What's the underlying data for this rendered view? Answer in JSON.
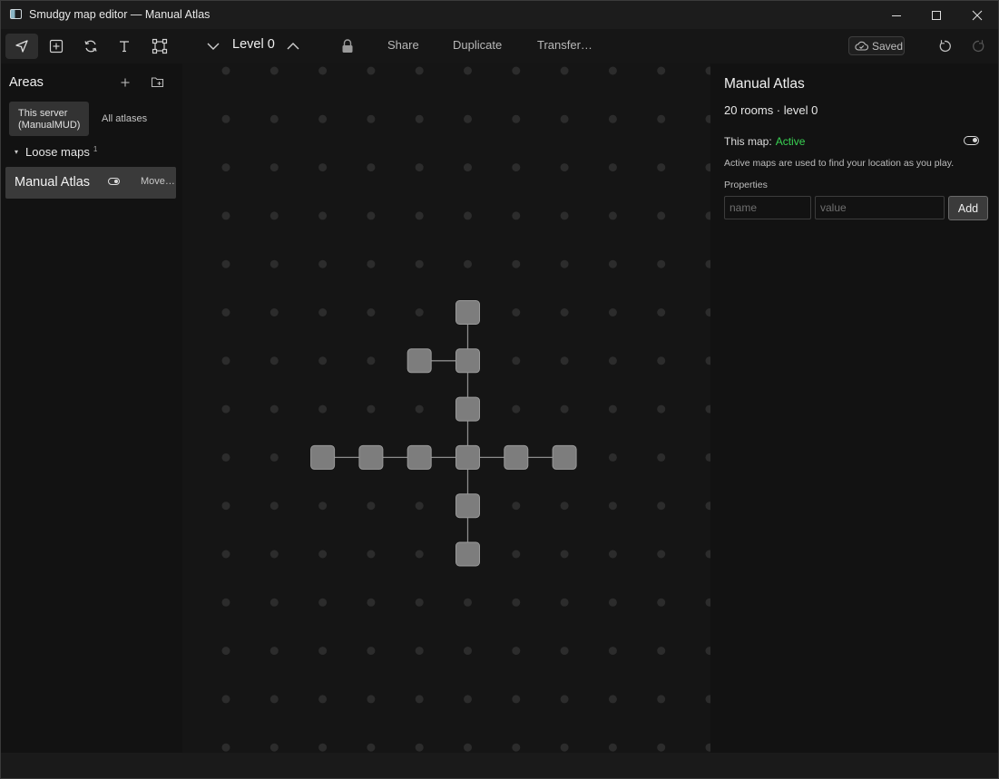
{
  "window": {
    "title": "Smudgy map editor — Manual Atlas",
    "controls": [
      "minimize",
      "maximize",
      "close"
    ]
  },
  "toolbar": {
    "tools": [
      {
        "name": "select-tool",
        "icon": "navigation-arrow-icon",
        "active": true
      },
      {
        "name": "add-room-tool",
        "icon": "plus-square-icon",
        "active": false
      },
      {
        "name": "cycle-tool",
        "icon": "refresh-icon",
        "active": false
      },
      {
        "name": "text-tool",
        "icon": "text-T-icon",
        "active": false
      },
      {
        "name": "area-select-tool",
        "icon": "bounding-box-icon",
        "active": false
      }
    ],
    "level_label": "Level 0",
    "share_label": "Share",
    "duplicate_label": "Duplicate",
    "transfer_label": "Transfer…",
    "saved_label": "Saved"
  },
  "sidebar": {
    "title": "Areas",
    "tab_server": "This server\n(ManualMUD)",
    "tab_all": "All atlases",
    "group_label": "Loose maps",
    "group_count": "1",
    "map_item": {
      "name": "Manual Atlas",
      "move_label": "Move…"
    }
  },
  "panel": {
    "title": "Manual Atlas",
    "subtitle": "20 rooms · level 0",
    "map_label": "This map:",
    "map_status": "Active",
    "note": "Active maps are used to find your location as you play.",
    "properties_label": "Properties",
    "name_placeholder": "name",
    "value_placeholder": "value",
    "add_label": "Add"
  },
  "map": {
    "rooms": [
      {
        "col": 5,
        "row": 5
      },
      {
        "col": 4,
        "row": 6
      },
      {
        "col": 5,
        "row": 6
      },
      {
        "col": 5,
        "row": 7
      },
      {
        "col": 2,
        "row": 8
      },
      {
        "col": 3,
        "row": 8
      },
      {
        "col": 4,
        "row": 8
      },
      {
        "col": 5,
        "row": 8
      },
      {
        "col": 6,
        "row": 8
      },
      {
        "col": 7,
        "row": 8
      },
      {
        "col": 5,
        "row": 9
      },
      {
        "col": 5,
        "row": 10
      }
    ],
    "exits": [
      [
        0,
        2
      ],
      [
        1,
        2
      ],
      [
        2,
        3
      ],
      [
        3,
        7
      ],
      [
        4,
        5
      ],
      [
        5,
        6
      ],
      [
        6,
        7
      ],
      [
        7,
        8
      ],
      [
        8,
        9
      ],
      [
        7,
        10
      ],
      [
        10,
        11
      ]
    ]
  },
  "colors": {
    "background": "#121212",
    "room": "#7d7d7d",
    "room_border": "#9a9a9a",
    "grid_dot": "#2c2c2c",
    "exit_line": "#8c8c8c",
    "active": "#39d353"
  }
}
